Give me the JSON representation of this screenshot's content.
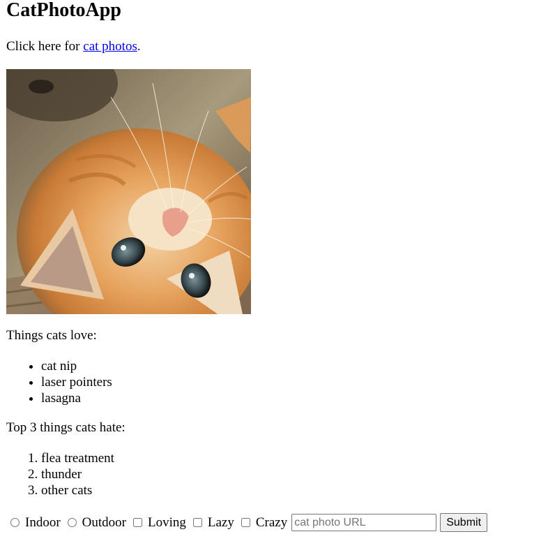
{
  "header": {
    "title": "CatPhotoApp"
  },
  "intro": {
    "prefix": "Click here for ",
    "link_text": "cat photos",
    "suffix": "."
  },
  "photo": {
    "alt": "A cute orange cat lying on its back."
  },
  "love_section": {
    "heading": "Things cats love:",
    "items": [
      "cat nip",
      "laser pointers",
      "lasagna"
    ]
  },
  "hate_section": {
    "heading": "Top 3 things cats hate:",
    "items": [
      "flea treatment",
      "thunder",
      "other cats"
    ]
  },
  "form": {
    "radios": [
      {
        "label": "Indoor",
        "checked": false
      },
      {
        "label": "Outdoor",
        "checked": false
      }
    ],
    "checkboxes": [
      {
        "label": "Loving",
        "checked": false
      },
      {
        "label": "Lazy",
        "checked": false
      },
      {
        "label": "Crazy",
        "checked": false
      }
    ],
    "url_input": {
      "value": "",
      "placeholder": "cat photo URL"
    },
    "submit_label": "Submit"
  },
  "colors": {
    "link": "#0000ee",
    "text": "#000000",
    "background": "#ffffff"
  }
}
